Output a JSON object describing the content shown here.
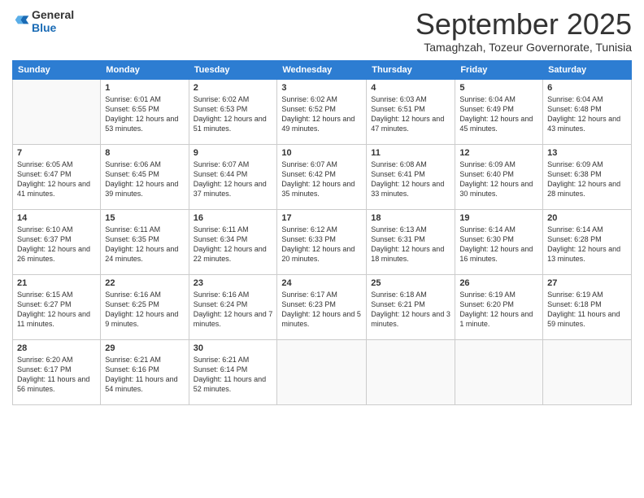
{
  "logo": {
    "general": "General",
    "blue": "Blue"
  },
  "title": "September 2025",
  "subtitle": "Tamaghzah, Tozeur Governorate, Tunisia",
  "headers": [
    "Sunday",
    "Monday",
    "Tuesday",
    "Wednesday",
    "Thursday",
    "Friday",
    "Saturday"
  ],
  "weeks": [
    [
      {
        "day": "",
        "sunrise": "",
        "sunset": "",
        "daylight": ""
      },
      {
        "day": "1",
        "sunrise": "Sunrise: 6:01 AM",
        "sunset": "Sunset: 6:55 PM",
        "daylight": "Daylight: 12 hours and 53 minutes."
      },
      {
        "day": "2",
        "sunrise": "Sunrise: 6:02 AM",
        "sunset": "Sunset: 6:53 PM",
        "daylight": "Daylight: 12 hours and 51 minutes."
      },
      {
        "day": "3",
        "sunrise": "Sunrise: 6:02 AM",
        "sunset": "Sunset: 6:52 PM",
        "daylight": "Daylight: 12 hours and 49 minutes."
      },
      {
        "day": "4",
        "sunrise": "Sunrise: 6:03 AM",
        "sunset": "Sunset: 6:51 PM",
        "daylight": "Daylight: 12 hours and 47 minutes."
      },
      {
        "day": "5",
        "sunrise": "Sunrise: 6:04 AM",
        "sunset": "Sunset: 6:49 PM",
        "daylight": "Daylight: 12 hours and 45 minutes."
      },
      {
        "day": "6",
        "sunrise": "Sunrise: 6:04 AM",
        "sunset": "Sunset: 6:48 PM",
        "daylight": "Daylight: 12 hours and 43 minutes."
      }
    ],
    [
      {
        "day": "7",
        "sunrise": "Sunrise: 6:05 AM",
        "sunset": "Sunset: 6:47 PM",
        "daylight": "Daylight: 12 hours and 41 minutes."
      },
      {
        "day": "8",
        "sunrise": "Sunrise: 6:06 AM",
        "sunset": "Sunset: 6:45 PM",
        "daylight": "Daylight: 12 hours and 39 minutes."
      },
      {
        "day": "9",
        "sunrise": "Sunrise: 6:07 AM",
        "sunset": "Sunset: 6:44 PM",
        "daylight": "Daylight: 12 hours and 37 minutes."
      },
      {
        "day": "10",
        "sunrise": "Sunrise: 6:07 AM",
        "sunset": "Sunset: 6:42 PM",
        "daylight": "Daylight: 12 hours and 35 minutes."
      },
      {
        "day": "11",
        "sunrise": "Sunrise: 6:08 AM",
        "sunset": "Sunset: 6:41 PM",
        "daylight": "Daylight: 12 hours and 33 minutes."
      },
      {
        "day": "12",
        "sunrise": "Sunrise: 6:09 AM",
        "sunset": "Sunset: 6:40 PM",
        "daylight": "Daylight: 12 hours and 30 minutes."
      },
      {
        "day": "13",
        "sunrise": "Sunrise: 6:09 AM",
        "sunset": "Sunset: 6:38 PM",
        "daylight": "Daylight: 12 hours and 28 minutes."
      }
    ],
    [
      {
        "day": "14",
        "sunrise": "Sunrise: 6:10 AM",
        "sunset": "Sunset: 6:37 PM",
        "daylight": "Daylight: 12 hours and 26 minutes."
      },
      {
        "day": "15",
        "sunrise": "Sunrise: 6:11 AM",
        "sunset": "Sunset: 6:35 PM",
        "daylight": "Daylight: 12 hours and 24 minutes."
      },
      {
        "day": "16",
        "sunrise": "Sunrise: 6:11 AM",
        "sunset": "Sunset: 6:34 PM",
        "daylight": "Daylight: 12 hours and 22 minutes."
      },
      {
        "day": "17",
        "sunrise": "Sunrise: 6:12 AM",
        "sunset": "Sunset: 6:33 PM",
        "daylight": "Daylight: 12 hours and 20 minutes."
      },
      {
        "day": "18",
        "sunrise": "Sunrise: 6:13 AM",
        "sunset": "Sunset: 6:31 PM",
        "daylight": "Daylight: 12 hours and 18 minutes."
      },
      {
        "day": "19",
        "sunrise": "Sunrise: 6:14 AM",
        "sunset": "Sunset: 6:30 PM",
        "daylight": "Daylight: 12 hours and 16 minutes."
      },
      {
        "day": "20",
        "sunrise": "Sunrise: 6:14 AM",
        "sunset": "Sunset: 6:28 PM",
        "daylight": "Daylight: 12 hours and 13 minutes."
      }
    ],
    [
      {
        "day": "21",
        "sunrise": "Sunrise: 6:15 AM",
        "sunset": "Sunset: 6:27 PM",
        "daylight": "Daylight: 12 hours and 11 minutes."
      },
      {
        "day": "22",
        "sunrise": "Sunrise: 6:16 AM",
        "sunset": "Sunset: 6:25 PM",
        "daylight": "Daylight: 12 hours and 9 minutes."
      },
      {
        "day": "23",
        "sunrise": "Sunrise: 6:16 AM",
        "sunset": "Sunset: 6:24 PM",
        "daylight": "Daylight: 12 hours and 7 minutes."
      },
      {
        "day": "24",
        "sunrise": "Sunrise: 6:17 AM",
        "sunset": "Sunset: 6:23 PM",
        "daylight": "Daylight: 12 hours and 5 minutes."
      },
      {
        "day": "25",
        "sunrise": "Sunrise: 6:18 AM",
        "sunset": "Sunset: 6:21 PM",
        "daylight": "Daylight: 12 hours and 3 minutes."
      },
      {
        "day": "26",
        "sunrise": "Sunrise: 6:19 AM",
        "sunset": "Sunset: 6:20 PM",
        "daylight": "Daylight: 12 hours and 1 minute."
      },
      {
        "day": "27",
        "sunrise": "Sunrise: 6:19 AM",
        "sunset": "Sunset: 6:18 PM",
        "daylight": "Daylight: 11 hours and 59 minutes."
      }
    ],
    [
      {
        "day": "28",
        "sunrise": "Sunrise: 6:20 AM",
        "sunset": "Sunset: 6:17 PM",
        "daylight": "Daylight: 11 hours and 56 minutes."
      },
      {
        "day": "29",
        "sunrise": "Sunrise: 6:21 AM",
        "sunset": "Sunset: 6:16 PM",
        "daylight": "Daylight: 11 hours and 54 minutes."
      },
      {
        "day": "30",
        "sunrise": "Sunrise: 6:21 AM",
        "sunset": "Sunset: 6:14 PM",
        "daylight": "Daylight: 11 hours and 52 minutes."
      },
      {
        "day": "",
        "sunrise": "",
        "sunset": "",
        "daylight": ""
      },
      {
        "day": "",
        "sunrise": "",
        "sunset": "",
        "daylight": ""
      },
      {
        "day": "",
        "sunrise": "",
        "sunset": "",
        "daylight": ""
      },
      {
        "day": "",
        "sunrise": "",
        "sunset": "",
        "daylight": ""
      }
    ]
  ]
}
